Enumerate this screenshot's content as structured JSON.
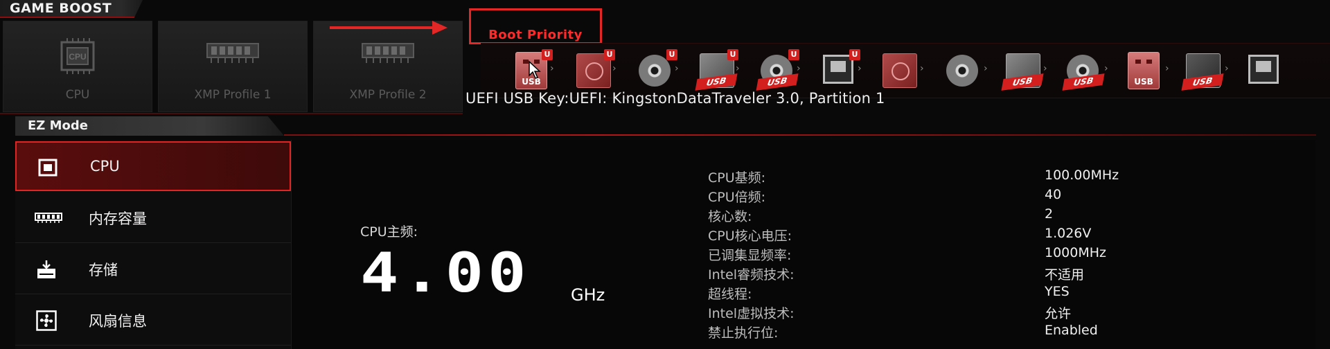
{
  "game_boost": {
    "title": "GAME BOOST",
    "tiles": [
      {
        "label": "CPU",
        "icon": "cpu-chip-icon"
      },
      {
        "label": "XMP Profile 1",
        "icon": "memory-module-icon"
      },
      {
        "label": "XMP Profile 2",
        "icon": "memory-module-icon"
      }
    ]
  },
  "annotation": {
    "label": "Boot Priority",
    "color": "#e32626"
  },
  "boot_priority": {
    "caption": "UEFI USB Key:UEFI: KingstonDataTraveler 3.0, Partition 1",
    "usb_tag": "USB",
    "uefi_badge": "U",
    "devices": [
      {
        "kind": "usb-key-red",
        "uefi": true
      },
      {
        "kind": "hdd-red",
        "uefi": true
      },
      {
        "kind": "optical-disc",
        "uefi": true
      },
      {
        "kind": "usb-drive",
        "uefi": true
      },
      {
        "kind": "usb-disc",
        "uefi": true
      },
      {
        "kind": "network",
        "uefi": true
      },
      {
        "kind": "hdd-red",
        "uefi": false
      },
      {
        "kind": "optical-disc",
        "uefi": false
      },
      {
        "kind": "usb-drive",
        "uefi": false
      },
      {
        "kind": "usb-disc",
        "uefi": false
      },
      {
        "kind": "usb-key-red",
        "uefi": false
      },
      {
        "kind": "usb-floppy",
        "uefi": false
      },
      {
        "kind": "network",
        "uefi": false
      }
    ]
  },
  "ez_mode": {
    "title": "EZ Mode",
    "accent": "#e12424",
    "sidebar": [
      {
        "label": "CPU",
        "icon": "cpu-icon",
        "active": true
      },
      {
        "label": "内存容量",
        "icon": "memory-icon",
        "active": false
      },
      {
        "label": "存储",
        "icon": "storage-icon",
        "active": false
      },
      {
        "label": "风扇信息",
        "icon": "fan-icon",
        "active": false
      }
    ],
    "cpu": {
      "freq_label": "CPU主频:",
      "freq_value": "4.00",
      "freq_unit": "GHz",
      "specs": [
        {
          "key": "CPU基频:",
          "value": "100.00MHz"
        },
        {
          "key": "CPU倍频:",
          "value": "40"
        },
        {
          "key": "核心数:",
          "value": "2"
        },
        {
          "key": "CPU核心电压:",
          "value": "1.026V"
        },
        {
          "key": "已调集显频率:",
          "value": "1000MHz"
        },
        {
          "key": "Intel睿频技术:",
          "value": "不适用"
        },
        {
          "key": "超线程:",
          "value": "YES"
        },
        {
          "key": "Intel虚拟技术:",
          "value": "允许"
        },
        {
          "key": "禁止执行位:",
          "value": "Enabled"
        }
      ]
    }
  }
}
